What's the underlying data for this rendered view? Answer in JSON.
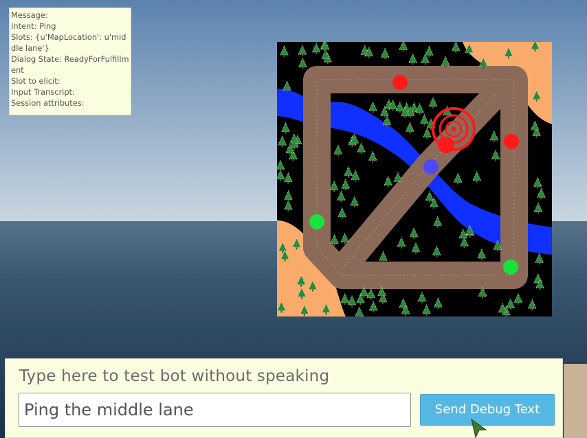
{
  "info_panel": {
    "lines": [
      "Message:",
      "Intent: Ping",
      "Slots: {u'MapLocation': u'middle lane'}",
      "Dialog State: ReadyForFulfillment",
      "Slot to elicit:",
      "Input Transcript:",
      "Session attributes:"
    ]
  },
  "debug": {
    "prompt": "Type here to test bot without speaking",
    "input_value": "Ping the middle lane",
    "send_label": "Send Debug Text"
  },
  "minimap": {
    "markers": {
      "red": [
        "top-lane-red-marker",
        "right-lane-red-marker",
        "red-base-marker"
      ],
      "green": [
        "left-lane-green-marker",
        "bottom-right-green-marker"
      ],
      "blue": [
        "middle-lane-blue-marker"
      ]
    }
  },
  "colors": {
    "sky_top": "#5f86b0",
    "sea": "#2c4a66",
    "panel_bg": "#fbfde1",
    "button": "#55b8e2",
    "lane": "#8c6a5a",
    "river": "#1030ff",
    "sand": "#f8ab6b",
    "ping": "#ff1a1a"
  },
  "icons": [
    "ping-target-icon",
    "mouse-cursor-icon",
    "pine-tree-icon"
  ]
}
